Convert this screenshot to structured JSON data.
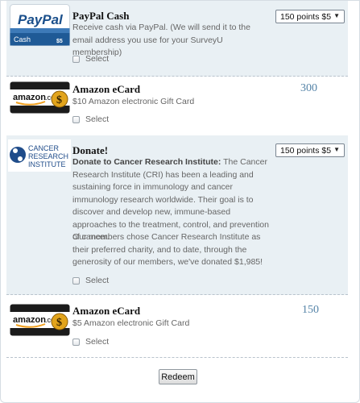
{
  "rewards": [
    {
      "title": "PayPal Cash",
      "description": "Receive cash via PayPal.  (We will send it to the email address you use for your SurveyU membership)",
      "select_label": "Select",
      "points_select": "150 points $5",
      "logo": {
        "brand": "PayPal",
        "card_text": "Cash",
        "amount": "$5",
        "icon": "paypal-cash-card"
      }
    },
    {
      "title": "Amazon eCard",
      "description": "$10 Amazon electronic Gift Card",
      "select_label": "Select",
      "points": "300",
      "logo": {
        "brand": "amazon",
        "suffix": ".com",
        "icon": "amazon-gift-card"
      }
    },
    {
      "title": "Donate!",
      "description_bold": "Donate to Cancer Research Institute:",
      "description": "The Cancer Research Institute (CRI) has been a leading and sustaining force in immunology and cancer immunology research worldwide. Their goal is to discover and develop new, immune-based approaches to the treatment, control, and prevention of cancer.",
      "description_2": "Our members chose Cancer Research Institute as their preferred charity, and to date, through the generosity of our members, we've donated $1,985!",
      "select_label": "Select",
      "points_select": "150 points $5",
      "logo": {
        "line1": "CANCER",
        "line2": "RESEARCH",
        "line3": "INSTITUTE",
        "icon": "cri-logo"
      }
    },
    {
      "title": "Amazon eCard",
      "description": "$5 Amazon electronic Gift Card",
      "select_label": "Select",
      "points": "150",
      "logo": {
        "brand": "amazon",
        "suffix": ".com",
        "icon": "amazon-gift-card"
      }
    }
  ],
  "redeem_label": "Redeem",
  "colors": {
    "shaded_row": "#e9f0f4",
    "points_text": "#5584a8",
    "paypal_blue": "#1a4f8b"
  }
}
